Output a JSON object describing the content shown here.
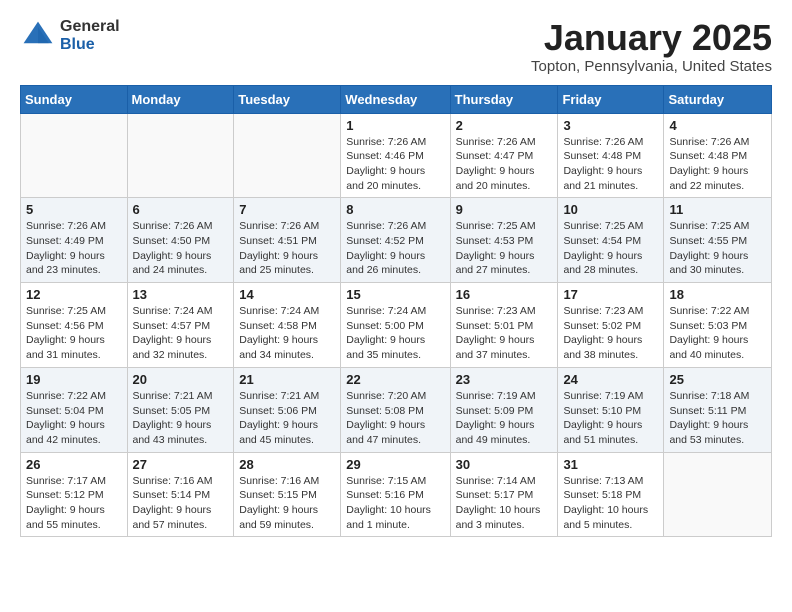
{
  "header": {
    "logo_general": "General",
    "logo_blue": "Blue",
    "title": "January 2025",
    "subtitle": "Topton, Pennsylvania, United States"
  },
  "days_of_week": [
    "Sunday",
    "Monday",
    "Tuesday",
    "Wednesday",
    "Thursday",
    "Friday",
    "Saturday"
  ],
  "weeks": [
    [
      {
        "day": "",
        "info": ""
      },
      {
        "day": "",
        "info": ""
      },
      {
        "day": "",
        "info": ""
      },
      {
        "day": "1",
        "info": "Sunrise: 7:26 AM\nSunset: 4:46 PM\nDaylight: 9 hours\nand 20 minutes."
      },
      {
        "day": "2",
        "info": "Sunrise: 7:26 AM\nSunset: 4:47 PM\nDaylight: 9 hours\nand 20 minutes."
      },
      {
        "day": "3",
        "info": "Sunrise: 7:26 AM\nSunset: 4:48 PM\nDaylight: 9 hours\nand 21 minutes."
      },
      {
        "day": "4",
        "info": "Sunrise: 7:26 AM\nSunset: 4:48 PM\nDaylight: 9 hours\nand 22 minutes."
      }
    ],
    [
      {
        "day": "5",
        "info": "Sunrise: 7:26 AM\nSunset: 4:49 PM\nDaylight: 9 hours\nand 23 minutes."
      },
      {
        "day": "6",
        "info": "Sunrise: 7:26 AM\nSunset: 4:50 PM\nDaylight: 9 hours\nand 24 minutes."
      },
      {
        "day": "7",
        "info": "Sunrise: 7:26 AM\nSunset: 4:51 PM\nDaylight: 9 hours\nand 25 minutes."
      },
      {
        "day": "8",
        "info": "Sunrise: 7:26 AM\nSunset: 4:52 PM\nDaylight: 9 hours\nand 26 minutes."
      },
      {
        "day": "9",
        "info": "Sunrise: 7:25 AM\nSunset: 4:53 PM\nDaylight: 9 hours\nand 27 minutes."
      },
      {
        "day": "10",
        "info": "Sunrise: 7:25 AM\nSunset: 4:54 PM\nDaylight: 9 hours\nand 28 minutes."
      },
      {
        "day": "11",
        "info": "Sunrise: 7:25 AM\nSunset: 4:55 PM\nDaylight: 9 hours\nand 30 minutes."
      }
    ],
    [
      {
        "day": "12",
        "info": "Sunrise: 7:25 AM\nSunset: 4:56 PM\nDaylight: 9 hours\nand 31 minutes."
      },
      {
        "day": "13",
        "info": "Sunrise: 7:24 AM\nSunset: 4:57 PM\nDaylight: 9 hours\nand 32 minutes."
      },
      {
        "day": "14",
        "info": "Sunrise: 7:24 AM\nSunset: 4:58 PM\nDaylight: 9 hours\nand 34 minutes."
      },
      {
        "day": "15",
        "info": "Sunrise: 7:24 AM\nSunset: 5:00 PM\nDaylight: 9 hours\nand 35 minutes."
      },
      {
        "day": "16",
        "info": "Sunrise: 7:23 AM\nSunset: 5:01 PM\nDaylight: 9 hours\nand 37 minutes."
      },
      {
        "day": "17",
        "info": "Sunrise: 7:23 AM\nSunset: 5:02 PM\nDaylight: 9 hours\nand 38 minutes."
      },
      {
        "day": "18",
        "info": "Sunrise: 7:22 AM\nSunset: 5:03 PM\nDaylight: 9 hours\nand 40 minutes."
      }
    ],
    [
      {
        "day": "19",
        "info": "Sunrise: 7:22 AM\nSunset: 5:04 PM\nDaylight: 9 hours\nand 42 minutes."
      },
      {
        "day": "20",
        "info": "Sunrise: 7:21 AM\nSunset: 5:05 PM\nDaylight: 9 hours\nand 43 minutes."
      },
      {
        "day": "21",
        "info": "Sunrise: 7:21 AM\nSunset: 5:06 PM\nDaylight: 9 hours\nand 45 minutes."
      },
      {
        "day": "22",
        "info": "Sunrise: 7:20 AM\nSunset: 5:08 PM\nDaylight: 9 hours\nand 47 minutes."
      },
      {
        "day": "23",
        "info": "Sunrise: 7:19 AM\nSunset: 5:09 PM\nDaylight: 9 hours\nand 49 minutes."
      },
      {
        "day": "24",
        "info": "Sunrise: 7:19 AM\nSunset: 5:10 PM\nDaylight: 9 hours\nand 51 minutes."
      },
      {
        "day": "25",
        "info": "Sunrise: 7:18 AM\nSunset: 5:11 PM\nDaylight: 9 hours\nand 53 minutes."
      }
    ],
    [
      {
        "day": "26",
        "info": "Sunrise: 7:17 AM\nSunset: 5:12 PM\nDaylight: 9 hours\nand 55 minutes."
      },
      {
        "day": "27",
        "info": "Sunrise: 7:16 AM\nSunset: 5:14 PM\nDaylight: 9 hours\nand 57 minutes."
      },
      {
        "day": "28",
        "info": "Sunrise: 7:16 AM\nSunset: 5:15 PM\nDaylight: 9 hours\nand 59 minutes."
      },
      {
        "day": "29",
        "info": "Sunrise: 7:15 AM\nSunset: 5:16 PM\nDaylight: 10 hours\nand 1 minute."
      },
      {
        "day": "30",
        "info": "Sunrise: 7:14 AM\nSunset: 5:17 PM\nDaylight: 10 hours\nand 3 minutes."
      },
      {
        "day": "31",
        "info": "Sunrise: 7:13 AM\nSunset: 5:18 PM\nDaylight: 10 hours\nand 5 minutes."
      },
      {
        "day": "",
        "info": ""
      }
    ]
  ]
}
